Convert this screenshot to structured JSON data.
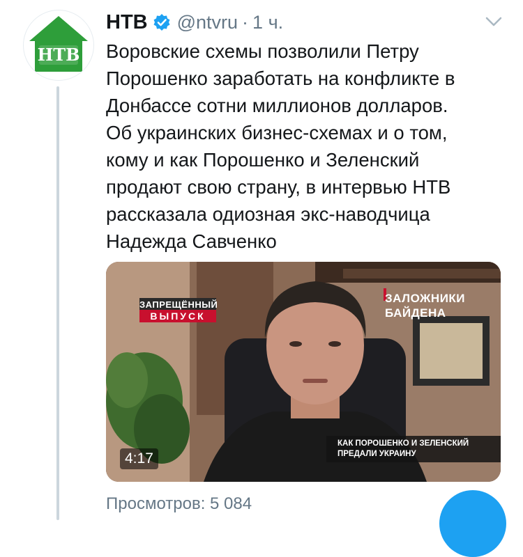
{
  "tweet": {
    "display_name": "НТВ",
    "handle": "@ntvru",
    "separator": "·",
    "time": "1 ч.",
    "text_lines": [
      "Воровские схемы позволили Петру",
      "Порошенко заработать на конфликте в",
      "Донбассе сотни миллионов долларов.",
      "Об украинских бизнес-схемах и о том,",
      "кому и как Порошенко и Зеленский",
      "продают свою страну, в интервью НТВ",
      "рассказала одиозная экс-наводчица",
      "Надежда Савченко"
    ],
    "avatar_logo": "НТВ"
  },
  "video": {
    "badge_left_line1": "ЗАПРЕЩЁННЫЙ",
    "badge_left_line2": "ВЫПУСК",
    "badge_right_line1": "ЗАЛОЖНИКИ",
    "badge_right_line2": "БАЙДЕНА",
    "caption_line1": "КАК ПОРОШЕНКО И ЗЕЛЕНСКИЙ",
    "caption_line2": "ПРЕДАЛИ УКРАИНУ",
    "duration": "4:17"
  },
  "footer": {
    "views": "Просмотров: 5 084"
  },
  "icons": {
    "verified": "verified-badge-icon",
    "menu": "chevron-down-icon",
    "compose": "compose-fab-icon"
  },
  "colors": {
    "brand_green": "#2e9e3a",
    "verified_blue": "#1da1f2",
    "secondary_text": "#657786",
    "badge_red": "#c8102e"
  }
}
